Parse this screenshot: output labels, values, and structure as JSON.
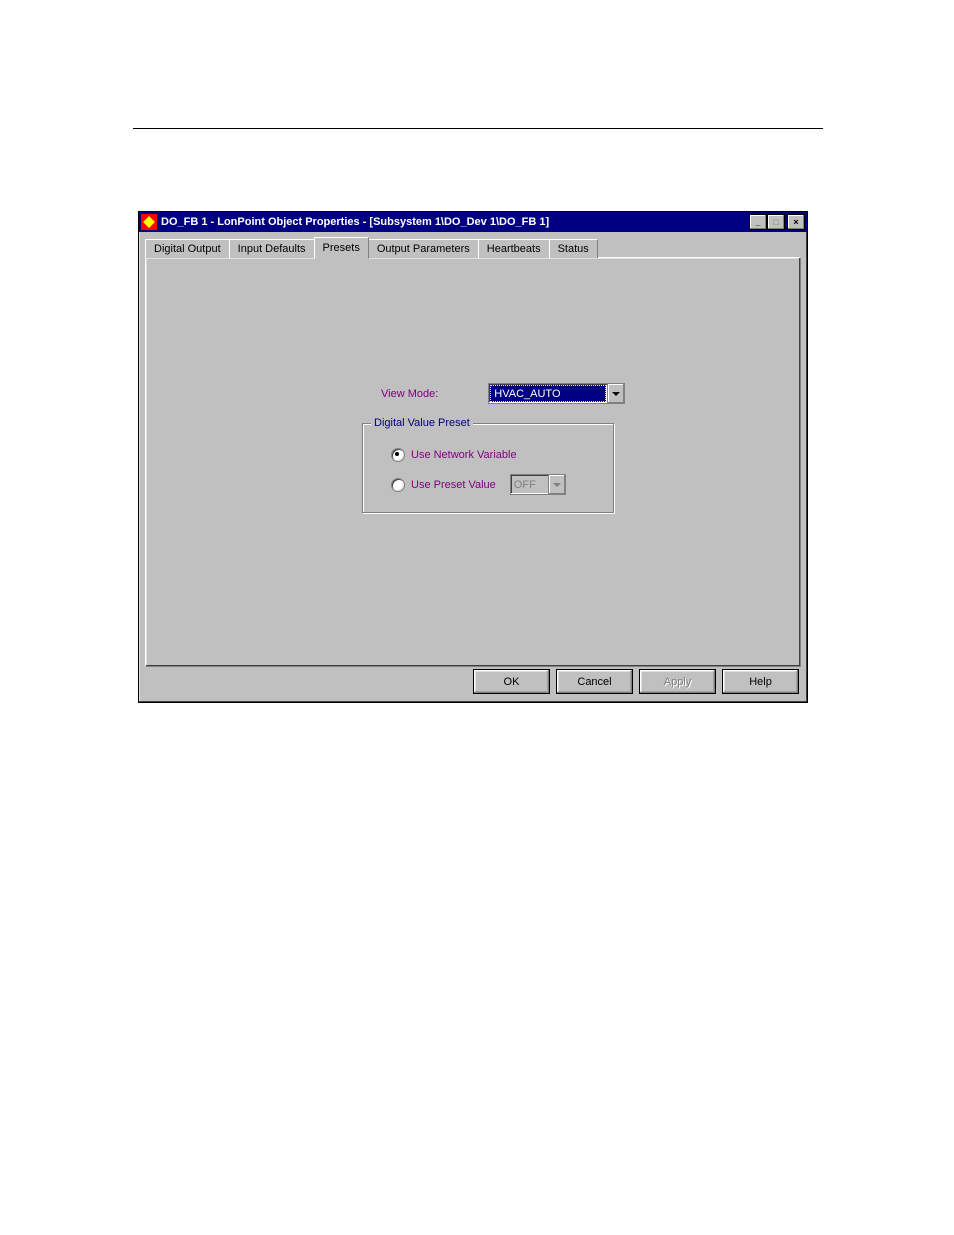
{
  "titlebar": {
    "title": "DO_FB 1 - LonPoint Object Properties - [Subsystem 1\\DO_Dev 1\\DO_FB 1]"
  },
  "tabs": [
    {
      "label": "Digital Output"
    },
    {
      "label": "Input Defaults"
    },
    {
      "label": "Presets"
    },
    {
      "label": "Output Parameters"
    },
    {
      "label": "Heartbeats"
    },
    {
      "label": "Status"
    }
  ],
  "viewmode": {
    "label": "View Mode:",
    "value": "HVAC_AUTO"
  },
  "group": {
    "legend": "Digital Value Preset",
    "opt_network": "Use Network Variable",
    "opt_preset": "Use Preset Value",
    "preset_value": "OFF"
  },
  "buttons": {
    "ok": "OK",
    "cancel": "Cancel",
    "apply": "Apply",
    "help": "Help"
  }
}
